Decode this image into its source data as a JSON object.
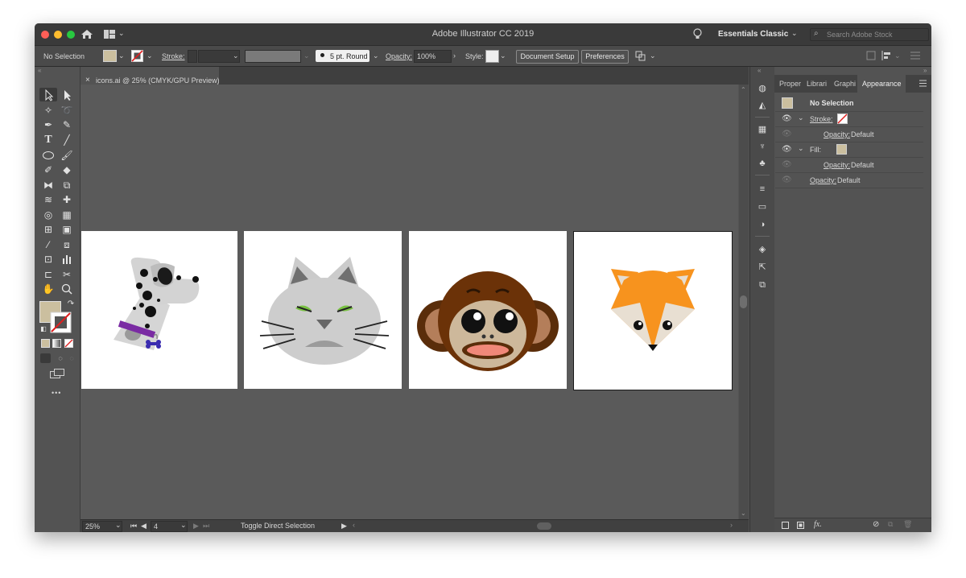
{
  "window": {
    "title": "Adobe Illustrator CC 2019"
  },
  "workspace": {
    "name": "Essentials Classic",
    "search_placeholder": "Search Adobe Stock"
  },
  "control_bar": {
    "selection_state": "No Selection",
    "stroke_label": "Stroke:",
    "brush_value": "5 pt. Round",
    "opacity_label": "Opacity:",
    "opacity_value": "100%",
    "style_label": "Style:",
    "document_setup": "Document Setup",
    "preferences": "Preferences"
  },
  "document": {
    "tab_title": "icons.ai @ 25% (CMYK/GPU Preview)",
    "close_glyph": "×"
  },
  "status_bar": {
    "zoom": "25%",
    "artboard_index": "4",
    "status_text": "Toggle Direct Selection"
  },
  "toolbar": {
    "more_glyph": "•••"
  },
  "panel": {
    "tabs": [
      "Proper",
      "Librari",
      "Graphi",
      "Appearance"
    ],
    "active_tab": "Appearance",
    "selection": "No Selection",
    "rows": {
      "stroke_label": "Stroke:",
      "stroke_opacity_label": "Opacity:",
      "stroke_opacity_value": "Default",
      "fill_label": "Fill:",
      "fill_opacity_label": "Opacity:",
      "fill_opacity_value": "Default",
      "opacity_label": "Opacity:",
      "opacity_value": "Default"
    },
    "footer_fx": "fx."
  },
  "colors": {
    "fill_swatch": "#cbbf9f",
    "ui_bg": "#535353",
    "canvas_bg": "#5a5a5a"
  },
  "artboards": [
    "dalmatian-dog",
    "gray-cat",
    "brown-monkey",
    "orange-fox"
  ]
}
